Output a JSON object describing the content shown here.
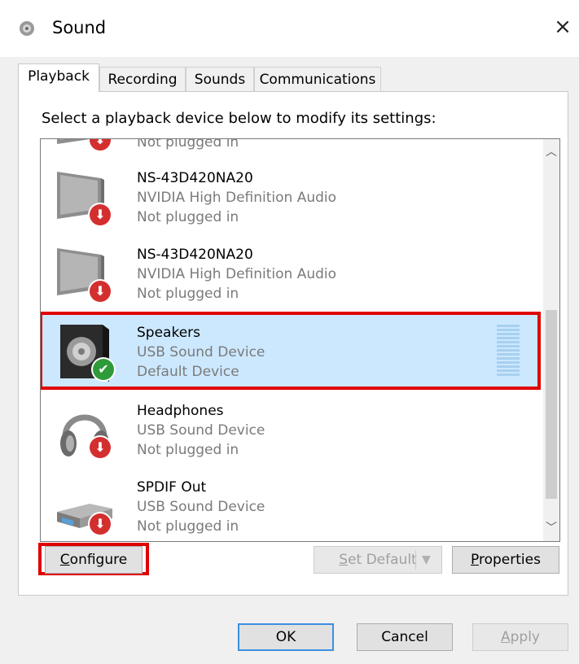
{
  "window": {
    "title": "Sound",
    "close_glyph": "×"
  },
  "tabs": [
    {
      "label": "Playback",
      "active": true
    },
    {
      "label": "Recording",
      "active": false
    },
    {
      "label": "Sounds",
      "active": false
    },
    {
      "label": "Communications",
      "active": false
    }
  ],
  "instruction": "Select a playback device below to modify its settings:",
  "devices": [
    {
      "name": "",
      "subtitle": "",
      "status": "Not plugged in",
      "icon": "monitor-icon",
      "badge": "red-down-arrow"
    },
    {
      "name": "NS-43D420NA20",
      "subtitle": "NVIDIA High Definition Audio",
      "status": "Not plugged in",
      "icon": "monitor-icon",
      "badge": "red-down-arrow"
    },
    {
      "name": "NS-43D420NA20",
      "subtitle": "NVIDIA High Definition Audio",
      "status": "Not plugged in",
      "icon": "monitor-icon",
      "badge": "red-down-arrow"
    },
    {
      "name": "Speakers",
      "subtitle": "USB Sound Device",
      "status": "Default Device",
      "icon": "speaker-icon",
      "badge": "green-check",
      "selected": true
    },
    {
      "name": "Headphones",
      "subtitle": "USB Sound Device",
      "status": "Not plugged in",
      "icon": "headphones-icon",
      "badge": "red-down-arrow"
    },
    {
      "name": "SPDIF Out",
      "subtitle": "USB Sound Device",
      "status": "Not plugged in",
      "icon": "spdif-device-icon",
      "badge": "red-down-arrow"
    }
  ],
  "buttons": {
    "configure": {
      "first": "C",
      "rest": "onfigure"
    },
    "set_default": {
      "first": "S",
      "rest": "et Default"
    },
    "properties": {
      "first": "P",
      "rest": "roperties"
    },
    "ok": "OK",
    "cancel": "Cancel",
    "apply": {
      "first": "A",
      "rest": "pply"
    }
  },
  "colors": {
    "selection": "#cce8ff",
    "highlight_border": "#e00000",
    "badge_red": "#d32f2f",
    "badge_green": "#2e9a3a"
  }
}
